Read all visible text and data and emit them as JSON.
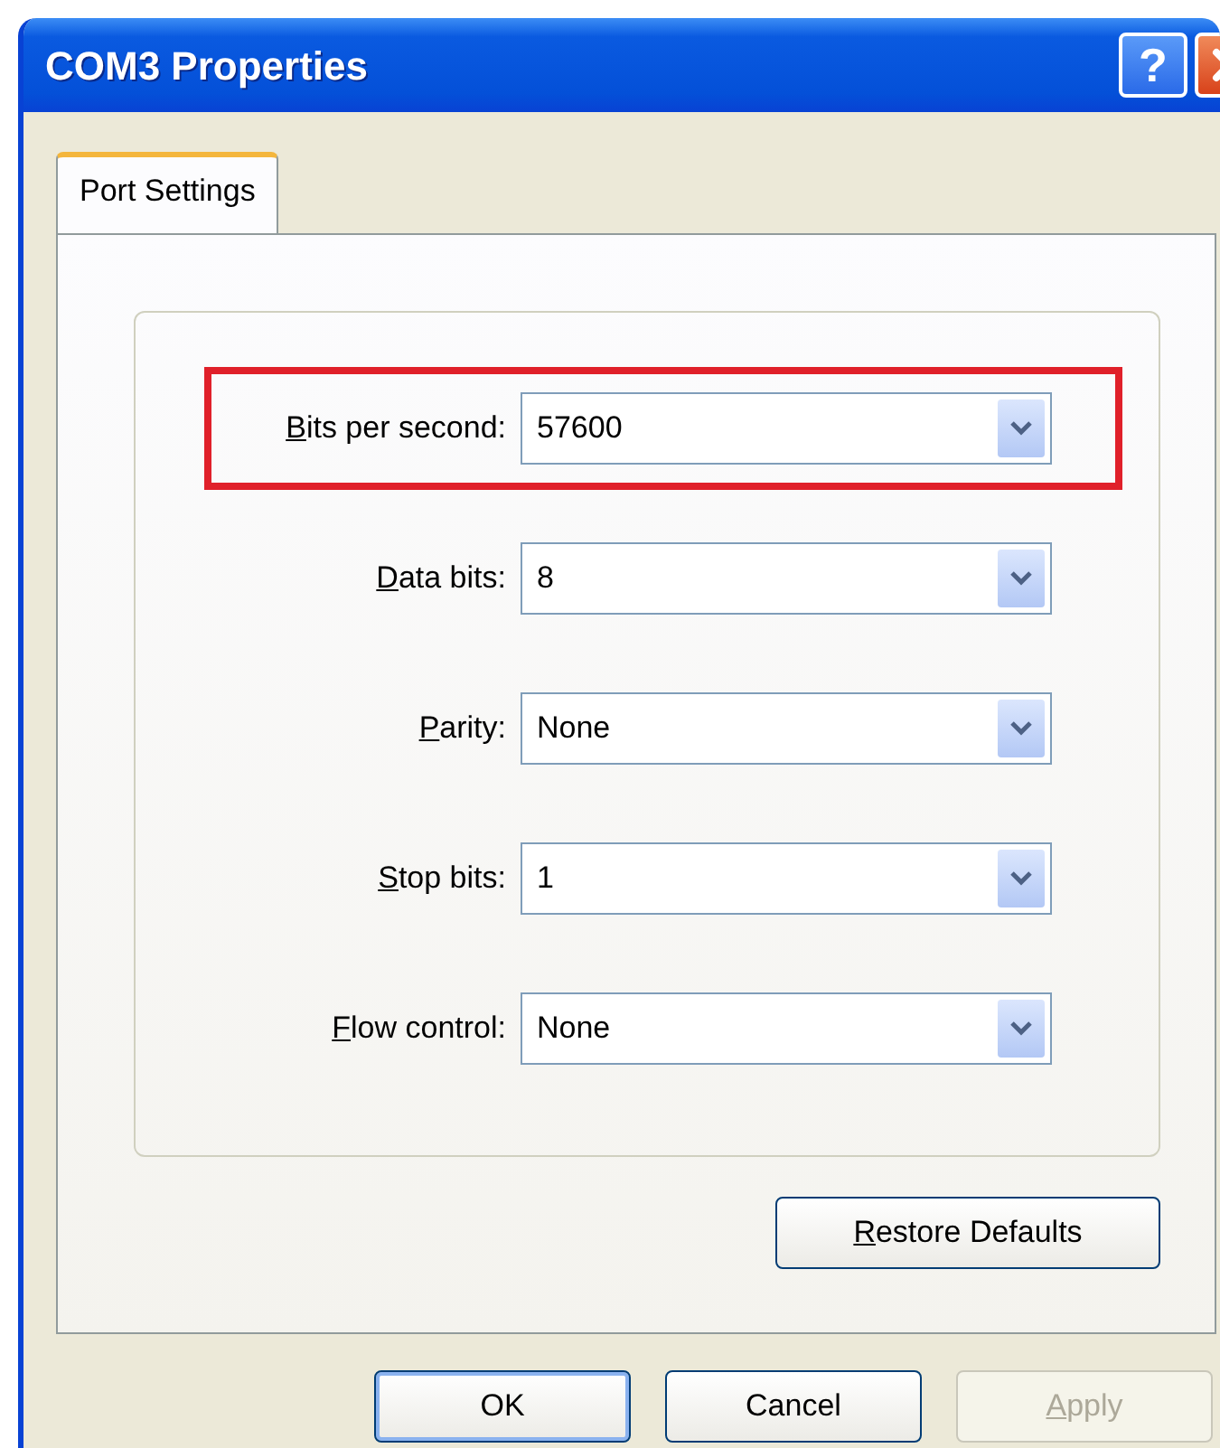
{
  "window": {
    "title": "COM3 Properties"
  },
  "title_buttons": [
    {
      "kind": "help",
      "label": "?"
    },
    {
      "kind": "close"
    }
  ],
  "tabs": [
    {
      "label": "Port Settings",
      "selected": true,
      "mnemonic": false
    }
  ],
  "fields": [
    {
      "label": "Bits per second:",
      "mnemonic": true,
      "value": "57600",
      "highlighted": true
    },
    {
      "label": "Data bits:",
      "mnemonic": true,
      "value": "8",
      "highlighted": false
    },
    {
      "label": "Parity:",
      "mnemonic": true,
      "value": "None",
      "highlighted": false
    },
    {
      "label": "Stop bits:",
      "mnemonic": true,
      "value": "1",
      "highlighted": false
    },
    {
      "label": "Flow control:",
      "mnemonic": true,
      "value": "None",
      "highlighted": false
    }
  ],
  "restore_button": {
    "label": "Restore Defaults",
    "mnemonic": true
  },
  "buttons": [
    {
      "label": "OK",
      "mnemonic": false,
      "disabled": false,
      "default": true
    },
    {
      "label": "Cancel",
      "mnemonic": false,
      "disabled": false,
      "default": false
    },
    {
      "label": "Apply",
      "mnemonic": true,
      "disabled": true,
      "default": false
    }
  ]
}
